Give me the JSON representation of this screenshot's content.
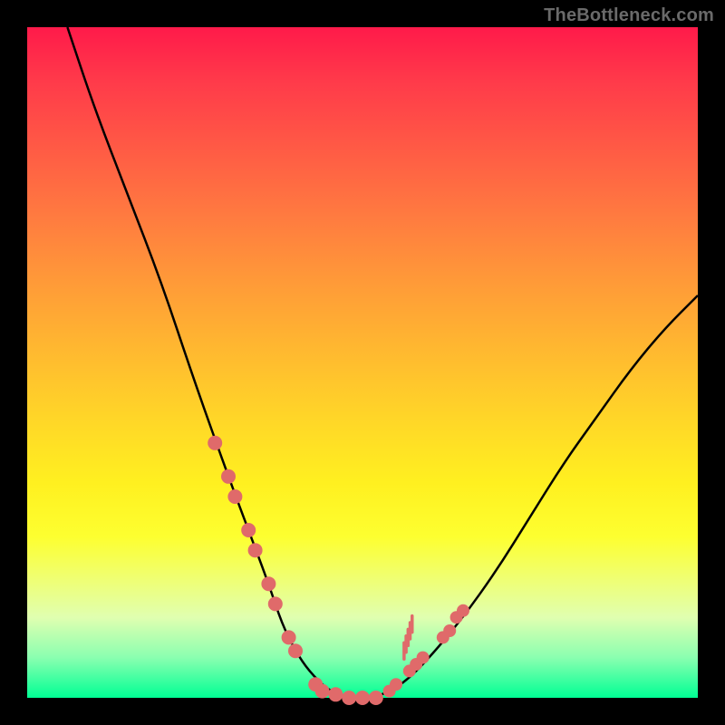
{
  "watermark": "TheBottleneck.com",
  "chart_data": {
    "type": "line",
    "title": "",
    "xlabel": "",
    "ylabel": "",
    "xlim": [
      0,
      100
    ],
    "ylim": [
      0,
      100
    ],
    "grid": false,
    "legend": false,
    "background_gradient_top": "#ff1a4a",
    "background_gradient_bottom": "#00ff94",
    "series": [
      {
        "name": "bottleneck-curve",
        "color": "#000000",
        "x": [
          6,
          10,
          15,
          20,
          25,
          30,
          33,
          36,
          38,
          40,
          42,
          45,
          48,
          52,
          56,
          60,
          65,
          70,
          75,
          80,
          85,
          90,
          95,
          100
        ],
        "y": [
          100,
          88,
          75,
          62,
          47,
          33,
          25,
          17,
          11,
          7,
          4,
          1,
          0,
          0,
          2,
          6,
          12,
          19,
          27,
          35,
          42,
          49,
          55,
          60
        ]
      }
    ],
    "markers": [
      {
        "name": "data-points-left",
        "color": "#e06a6a",
        "shape": "circle",
        "points": [
          {
            "x": 28,
            "y": 38
          },
          {
            "x": 30,
            "y": 33
          },
          {
            "x": 31,
            "y": 30
          },
          {
            "x": 33,
            "y": 25
          },
          {
            "x": 34,
            "y": 22
          },
          {
            "x": 36,
            "y": 17
          },
          {
            "x": 37,
            "y": 14
          },
          {
            "x": 39,
            "y": 9
          },
          {
            "x": 40,
            "y": 7
          },
          {
            "x": 43,
            "y": 2
          },
          {
            "x": 44,
            "y": 1
          },
          {
            "x": 46,
            "y": 0.5
          },
          {
            "x": 48,
            "y": 0
          },
          {
            "x": 50,
            "y": 0
          },
          {
            "x": 52,
            "y": 0
          }
        ]
      },
      {
        "name": "data-points-right",
        "color": "#e06a6a",
        "shape": "circle",
        "points": [
          {
            "x": 54,
            "y": 1
          },
          {
            "x": 55,
            "y": 2
          },
          {
            "x": 57,
            "y": 4
          },
          {
            "x": 58,
            "y": 5
          },
          {
            "x": 59,
            "y": 6
          },
          {
            "x": 62,
            "y": 9
          },
          {
            "x": 63,
            "y": 10
          },
          {
            "x": 64,
            "y": 12
          },
          {
            "x": 65,
            "y": 13
          }
        ]
      },
      {
        "name": "vertical-tick-cluster",
        "color": "#e06a6a",
        "shape": "tick",
        "points": [
          {
            "x": 56.2,
            "y": 7
          },
          {
            "x": 56.5,
            "y": 8
          },
          {
            "x": 56.8,
            "y": 9
          },
          {
            "x": 57.1,
            "y": 10
          },
          {
            "x": 57.4,
            "y": 11
          }
        ]
      }
    ]
  }
}
